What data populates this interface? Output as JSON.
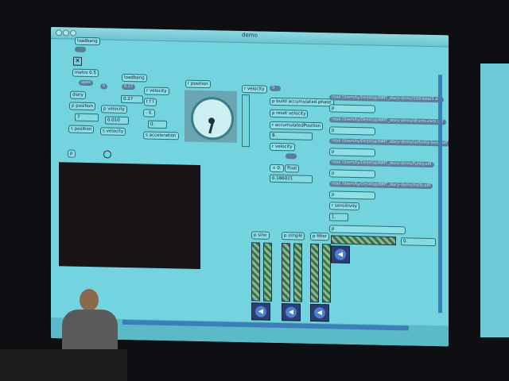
{
  "window": {
    "title": "demo"
  },
  "objects": {
    "loadbang1": "loadbang",
    "metro": "metro 0.5",
    "open": "open",
    "diary": "diary",
    "p_position": "p position",
    "num7": "7",
    "s_position": "s position",
    "loadbang2": "loadbang",
    "msg0": "0",
    "msg027": "0.27",
    "num027": "0.27",
    "p_velocity": "p velocity",
    "num0010": "0.010",
    "s_velocity": "s velocity",
    "r_velocity1": "r velocity",
    "tff": "t f f",
    "minus0": "- 0.",
    "num0": "0.",
    "s_acceleration": "s acceleration",
    "r_position": "r position",
    "r_velocity2": "r velocity",
    "msg_c": "0",
    "p_build": "p build accumulated phase",
    "p_reset": "p reset velocity",
    "r_accum": "r accumulatedPosition",
    "num8": "8.",
    "r_velocity3": "r velocity",
    "plus0": "+ 0.",
    "float": "float",
    "num_vel": "0.186021",
    "r_sensitivity": "r sensitivity",
    "num1": "1.",
    "num_out": "0.",
    "p_sine": "p sine",
    "p_simple": "p simple",
    "p_filter": "p filter"
  },
  "read_messages": [
    "read /Users/ty/Desktop/NMT_diary-demo/100-beat1.aiff",
    "read /Users/ty/Desktop/NMT_diary-demo/drums-cars.aiff",
    "read /Users/ty/Desktop/NMT_diary-demo/unfunky-beat.aiff",
    "read /Users/ty/Desktop/NMT_diary-demo/funky.aiff",
    "read /Users/ty/Desktop/NMT_diary-demo/hello.aiff"
  ],
  "sfplay_label": "p",
  "icons": {
    "speaker": "speaker-icon",
    "dial": "dial-icon",
    "toggle": "toggle-icon"
  }
}
